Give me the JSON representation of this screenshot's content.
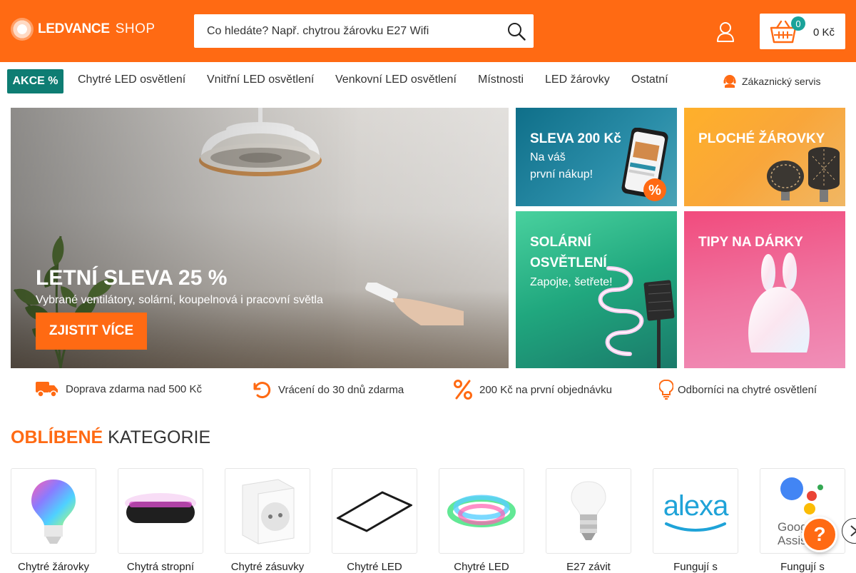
{
  "header": {
    "logo_brand": "LEDVANCE",
    "logo_shop": "SHOP",
    "search_placeholder": "Co hledáte? Např. chytrou žárovku E27 Wifi",
    "cart_count": "0",
    "cart_total": "0 Kč",
    "brand_color": "#ff6a13"
  },
  "nav": {
    "akce": "AKCE %",
    "items": [
      "Chytré LED osvětlení",
      "Vnitřní LED osvětlení",
      "Venkovní LED osvětlení",
      "Místnosti",
      "LED žárovky",
      "Ostatní"
    ],
    "service": "Zákaznický servis"
  },
  "hero": {
    "title": "LETNÍ SLEVA 25 %",
    "subtitle": "Vybrané ventilátory, solární, koupelnová i pracovní světla",
    "cta": "ZJISTIT VÍCE"
  },
  "tiles": [
    {
      "title": "SLEVA 200 Kč",
      "subtitle_line1": "Na váš",
      "subtitle_line2": "první nákup!"
    },
    {
      "title": "PLOCHÉ ŽÁROVKY"
    },
    {
      "title_line1": "SOLÁRNÍ",
      "title_line2": "OSVĚTLENÍ",
      "subtitle": "Zapojte, šetřete!"
    },
    {
      "title": "TIPY NA DÁRKY"
    }
  ],
  "usp": [
    {
      "icon": "truck-icon",
      "text": "Doprava zdarma nad 500 Kč"
    },
    {
      "icon": "return-icon",
      "text": "Vrácení do 30 dnů zdarma"
    },
    {
      "icon": "percent-icon",
      "text": "200 Kč na první objednávku"
    },
    {
      "icon": "bulb-icon",
      "text": "Odborníci na chytré osvětlení"
    }
  ],
  "categories": {
    "title_accent": "OBLÍBENÉ",
    "title_rest": "KATEGORIE",
    "items": [
      "Chytré žárovky",
      "Chytrá stropní",
      "Chytré zásuvky",
      "Chytré LED",
      "Chytré LED",
      "E27 závit",
      "Fungují s",
      "Fungují s"
    ],
    "alexa_text": "alexa",
    "google_text": "Google Assistant"
  },
  "help": "?"
}
